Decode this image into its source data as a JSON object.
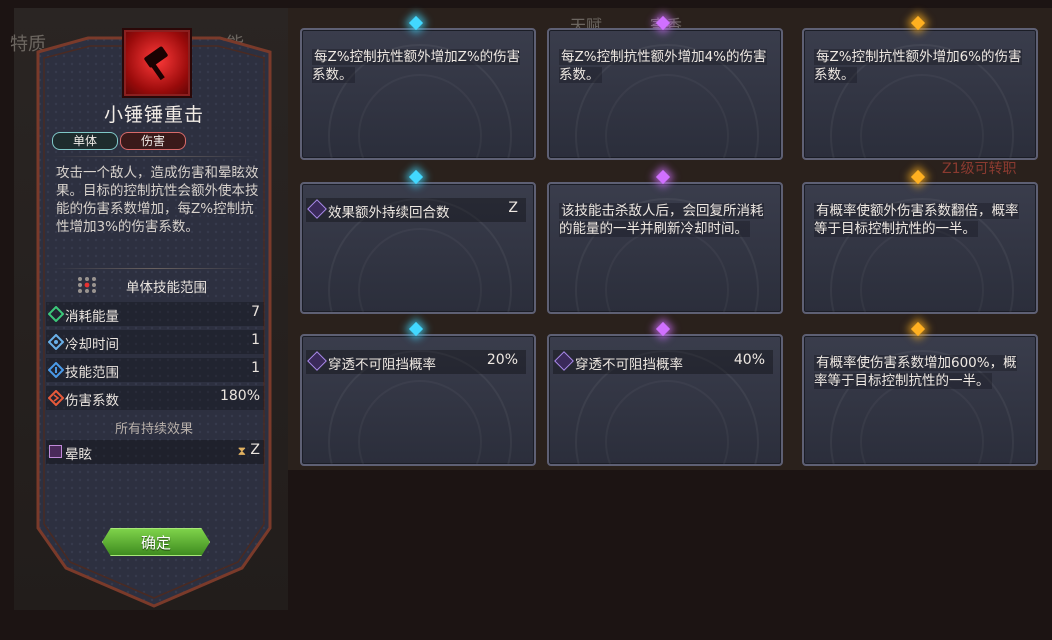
{
  "background": {
    "left_tags": [
      "特质",
      "能"
    ],
    "top_tags": [
      "天赋",
      "寄香"
    ],
    "right_tags": [
      "Z1级可转职"
    ]
  },
  "skill": {
    "title": "小锤锤重击",
    "tags": [
      "单体",
      "伤害"
    ],
    "description": "攻击一个敌人，造成伤害和晕眩效果。目标的控制抗性会额外使本技能的伤害系数增加，每Z%控制抗性增加3%的伤害系数。",
    "range_label": "单体技能范围",
    "stats": [
      {
        "label": "消耗能量",
        "value": "7",
        "icon": "energy-icon",
        "color": "#3cc87a"
      },
      {
        "label": "冷却时间",
        "value": "1",
        "icon": "cooldown-icon",
        "color": "#6ab0e8"
      },
      {
        "label": "技能范围",
        "value": "1",
        "icon": "range-icon",
        "color": "#4a9ae8"
      },
      {
        "label": "伤害系数",
        "value": "180%",
        "icon": "damage-icon",
        "color": "#e85a3a"
      }
    ],
    "effects_title": "所有持续效果",
    "effects": [
      {
        "label": "晕眩",
        "duration": "Z",
        "icon": "stun-icon"
      }
    ],
    "confirm_label": "确定"
  },
  "upgrades": [
    {
      "tier": "blue",
      "column": 0,
      "row": 0,
      "type": "text",
      "text": "每Z%控制抗性额外增加Z%的伤害系数。"
    },
    {
      "tier": "purple",
      "column": 1,
      "row": 0,
      "type": "text",
      "text": "每Z%控制抗性额外增加4%的伤害系数。"
    },
    {
      "tier": "gold",
      "column": 2,
      "row": 0,
      "type": "text",
      "text": "每Z%控制抗性额外增加6%的伤害系数。"
    },
    {
      "tier": "blue",
      "column": 0,
      "row": 1,
      "type": "stat",
      "label": "效果额外持续回合数",
      "value": "Z"
    },
    {
      "tier": "purple",
      "column": 1,
      "row": 1,
      "type": "text",
      "text": "该技能击杀敌人后，会回复所消耗的能量的一半并刷新冷却时间。"
    },
    {
      "tier": "gold",
      "column": 2,
      "row": 1,
      "type": "text",
      "text": "有概率使额外伤害系数翻倍，概率等于目标控制抗性的一半。"
    },
    {
      "tier": "blue",
      "column": 0,
      "row": 2,
      "type": "stat",
      "label": "穿透不可阻挡概率",
      "value": "20%"
    },
    {
      "tier": "purple",
      "column": 1,
      "row": 2,
      "type": "stat",
      "label": "穿透不可阻挡概率",
      "value": "40%"
    },
    {
      "tier": "gold",
      "column": 2,
      "row": 2,
      "type": "text",
      "text": "有概率使伤害系数增加600%，概率等于目标控制抗性的一半。"
    }
  ]
}
